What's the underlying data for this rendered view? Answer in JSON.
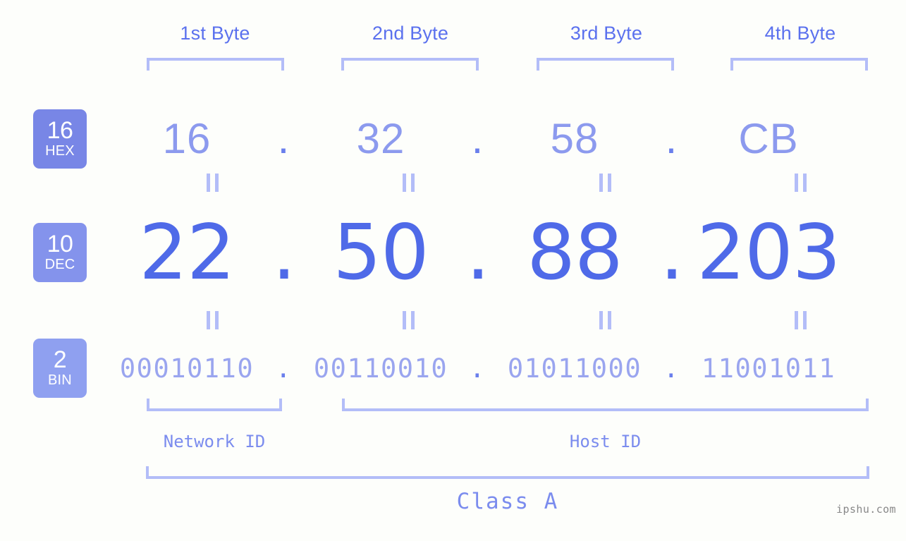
{
  "page": {
    "background_color": "#fdfefb",
    "accent_color": "#4f6ae8",
    "bracket_color": "#b3bdf8",
    "watermark": "ipshu.com"
  },
  "byte_headers": [
    {
      "label": "1st Byte"
    },
    {
      "label": "2nd Byte"
    },
    {
      "label": "3rd Byte"
    },
    {
      "label": "4th Byte"
    }
  ],
  "radix_badges": [
    {
      "number": "16",
      "system": "HEX",
      "color": "#7886e6"
    },
    {
      "number": "10",
      "system": "DEC",
      "color": "#8493ec"
    },
    {
      "number": "2",
      "system": "BIN",
      "color": "#8fa0f0"
    }
  ],
  "rows": {
    "hex": {
      "name": "hexadecimal",
      "values": [
        "16",
        "32",
        "58",
        "CB"
      ],
      "separator": "."
    },
    "dec": {
      "name": "decimal",
      "values": [
        "22",
        "50",
        "88",
        "203"
      ],
      "separator": ".",
      "address": "22.50.88.203"
    },
    "bin": {
      "name": "binary",
      "values": [
        "00010110",
        "00110010",
        "01011000",
        "11001011"
      ],
      "separator": ".",
      "address": "00010110.00110010.01011000.11001011"
    }
  },
  "equals_marks": {
    "glyph": "=",
    "count_per_row": 4
  },
  "segments": {
    "network_id": "Network ID",
    "host_id": "Host ID",
    "ip_class": "Class A"
  }
}
